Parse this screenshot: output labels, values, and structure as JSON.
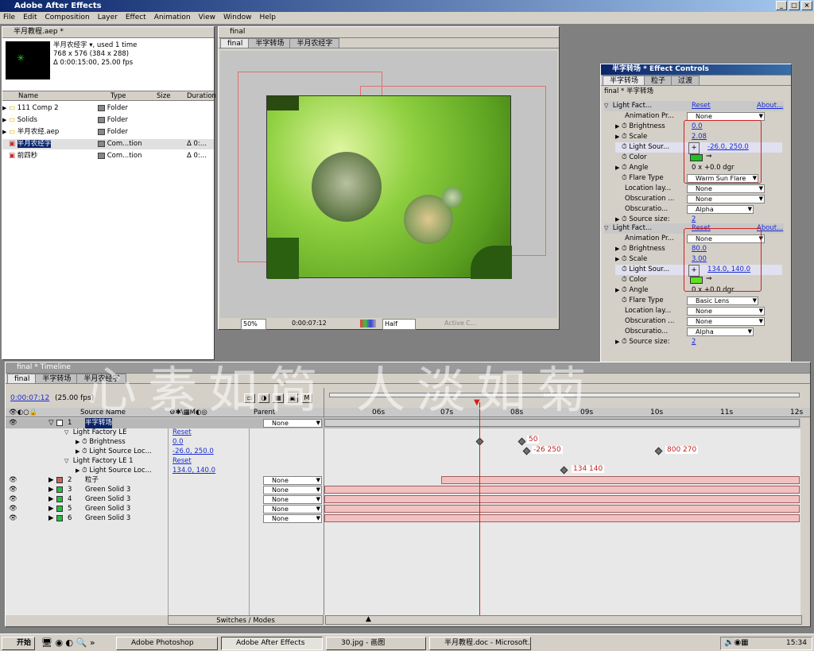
{
  "app": {
    "title": "Adobe After Effects"
  },
  "menu": [
    "File",
    "Edit",
    "Composition",
    "Layer",
    "Effect",
    "Animation",
    "View",
    "Window",
    "Help"
  ],
  "project": {
    "title": "半月教程.aep *",
    "comp_name": "半月农经字 ▾, used 1 time",
    "comp_size": "768 x 576  (384 x 288)",
    "comp_dur": "Δ 0:00:15:00, 25.00 fps",
    "headers": [
      "Name",
      "Type",
      "Size",
      "Duration"
    ],
    "items": [
      {
        "name": "111 Comp 2",
        "type": "Folder",
        "dur": ""
      },
      {
        "name": "Solids",
        "type": "Folder",
        "dur": ""
      },
      {
        "name": "半月农经.aep",
        "type": "Folder",
        "dur": ""
      },
      {
        "name": "半月农经字",
        "type": "Com...tion",
        "dur": "Δ 0:..."
      },
      {
        "name": "前四秒",
        "type": "Com...tion",
        "dur": "Δ 0:..."
      }
    ]
  },
  "comp": {
    "title": "final",
    "tabs": [
      "final",
      "半字转场",
      "半月农经字"
    ],
    "zoom": "50%",
    "time": "0:00:07:12",
    "res": "Half",
    "camera": "Active C..."
  },
  "effects": {
    "title": "半字转场 * Effect Controls",
    "tabs": [
      "半字转场",
      "粒子",
      "过渡"
    ],
    "path": "final * 半字转场",
    "fx1": {
      "name": "Light Fact...",
      "reset": "Reset",
      "about": "About...",
      "anim_label": "Animation Pr...",
      "anim": "None",
      "brightness_label": "Brightness",
      "brightness": "0.0",
      "scale_label": "Scale",
      "scale": "2.08",
      "light_label": "Light Sour...",
      "light": "-26.0, 250.0",
      "color_label": "Color",
      "angle_label": "Angle",
      "angle": "0 x +0.0 dgr",
      "flare_label": "Flare Type",
      "flare": "Warm Sun Flare",
      "loc_label": "Location lay...",
      "loc": "None",
      "obs_label": "Obscuration ...",
      "obs": "None",
      "obs2_label": "Obscuratio...",
      "obs2": "Alpha",
      "src_label": "Source size:",
      "src": "2"
    },
    "fx2": {
      "name": "Light Fact...",
      "reset": "Reset",
      "about": "About...",
      "anim_label": "Animation Pr...",
      "anim": "None",
      "brightness_label": "Brightness",
      "brightness": "80.0",
      "scale_label": "Scale",
      "scale": "3.00",
      "light_label": "Light Sour...",
      "light": "134.0, 140.0",
      "color_label": "Color",
      "angle_label": "Angle",
      "angle": "0 x +0.0 dgr",
      "flare_label": "Flare Type",
      "flare": "Basic Lens",
      "loc_label": "Location lay...",
      "loc": "None",
      "obs_label": "Obscuration ...",
      "obs": "None",
      "obs2_label": "Obscuratio...",
      "obs2": "Alpha",
      "src_label": "Source size:",
      "src": "2"
    }
  },
  "timeline": {
    "title": "final * Timeline",
    "tabs": [
      "final",
      "半字转场",
      "半月农经字"
    ],
    "time": "0:00:07:12",
    "fps": "(25.00 fps)",
    "col_source": "Source Name",
    "col_parent": "Parent",
    "switches": "Switches / Modes",
    "ticks": [
      "06s",
      "07s",
      "08s",
      "09s",
      "10s",
      "11s",
      "12s"
    ],
    "layers": [
      {
        "num": "1",
        "name": "半字转场",
        "parent": "None",
        "color": "#ffffff"
      },
      {
        "num": "2",
        "name": "粒子",
        "parent": "None",
        "color": "#d06060"
      },
      {
        "num": "3",
        "name": "Green Solid 3",
        "parent": "None",
        "color": "#20c040"
      },
      {
        "num": "4",
        "name": "Green Solid 3",
        "parent": "None",
        "color": "#20c040"
      },
      {
        "num": "5",
        "name": "Green Solid 3",
        "parent": "None",
        "color": "#20c040"
      },
      {
        "num": "6",
        "name": "Green Solid 3",
        "parent": "None",
        "color": "#20c040"
      }
    ],
    "fx_a": "Light Factory LE",
    "fx_a_reset": "Reset",
    "bright_label": "Brightness",
    "bright": "0.0",
    "lsrc_label": "Light Source Loc...",
    "lsrc": "-26.0, 250.0",
    "fx_b": "Light Factory LE 1",
    "fx_b_reset": "Reset",
    "lsrc_b": "134.0, 140.0",
    "kf_notes": {
      "a": "50",
      "b": "-26 250",
      "c": "800 270",
      "d": "134 140"
    }
  },
  "watermark": "心素如简 人淡如菊",
  "taskbar": {
    "start": "开始",
    "items": [
      "Adobe Photoshop",
      "Adobe After Effects",
      "30.jpg - 画图",
      "半月教程.doc - Microsoft..."
    ],
    "clock": "15:34"
  }
}
